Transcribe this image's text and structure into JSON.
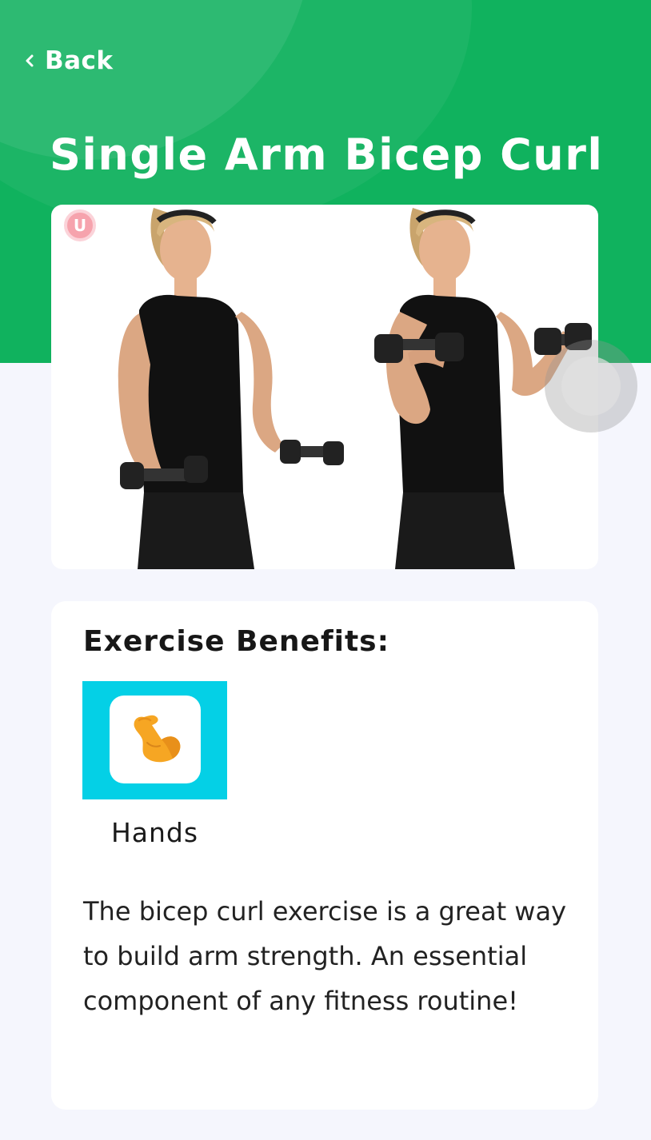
{
  "header": {
    "back_label": "Back",
    "title": "Single Arm Bicep Curl"
  },
  "exercise_image": {
    "watermark_letter": "U"
  },
  "benefits": {
    "heading": "Exercise Benefits:",
    "items": [
      {
        "label": "Hands",
        "icon": "flexed-biceps-icon"
      }
    ],
    "description": "The bicep curl exercise is a great way to build arm strength. An essential component of any fitness routine!"
  },
  "colors": {
    "header_green": "#10b25e",
    "tile_cyan": "#04d0e6",
    "page_background": "#f5f6fd"
  }
}
